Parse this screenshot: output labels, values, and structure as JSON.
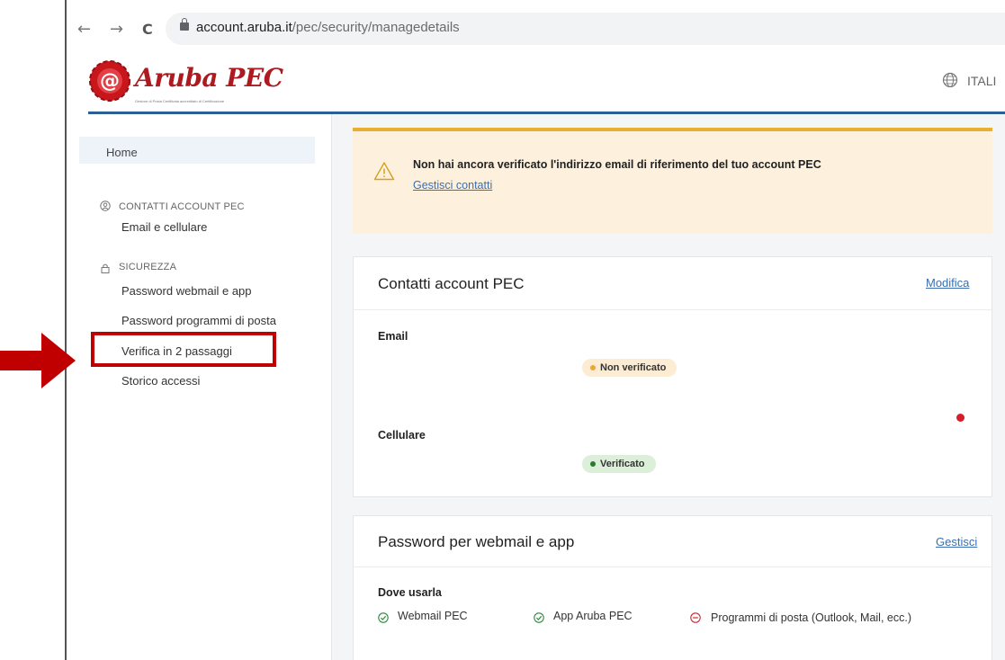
{
  "browser": {
    "back_icon": "←",
    "forward_icon": "→",
    "reload_icon": "C",
    "url_host": "account.aruba.it",
    "url_path": "/pec/security/managedetails"
  },
  "header": {
    "logo_text": "Aruba PEC",
    "logo_subtitle": "Gestore di Posta Certificata accreditato di Certificazione",
    "language": "ITALI"
  },
  "sidebar": {
    "home": "Home",
    "contacts_section": "CONTATTI ACCOUNT PEC",
    "contacts_items": [
      "Email e cellulare"
    ],
    "security_section": "SICUREZZA",
    "security_items": [
      "Password webmail e app",
      "Password programmi di posta",
      "Verifica in 2 passaggi",
      "Storico accessi"
    ]
  },
  "warning": {
    "message": "Non hai ancora verificato l'indirizzo email di riferimento del tuo account PEC",
    "link": "Gestisci contatti"
  },
  "contacts_card": {
    "title": "Contatti account PEC",
    "action": "Modifica",
    "email_label": "Email",
    "email_status": "Non verificato",
    "phone_label": "Cellulare",
    "phone_status": "Verificato"
  },
  "password_card": {
    "title": "Password per webmail e app",
    "action": "Gestisci",
    "where_label": "Dove usarla",
    "uses": [
      "Webmail PEC",
      "App Aruba PEC",
      "Programmi di posta (Outlook, Mail, ecc.)"
    ]
  },
  "colors": {
    "brand_red": "#ad1a20",
    "header_line": "#2b5f95",
    "warning_border": "#e9ae34",
    "link": "#3a6fb0",
    "annotation_red": "#c00000"
  },
  "icons": {
    "contacts": "user-circle-icon",
    "security": "lock-icon",
    "warning": "warning-triangle-icon",
    "language": "globe-icon",
    "check": "check-circle-icon",
    "minus": "minus-circle-icon"
  }
}
